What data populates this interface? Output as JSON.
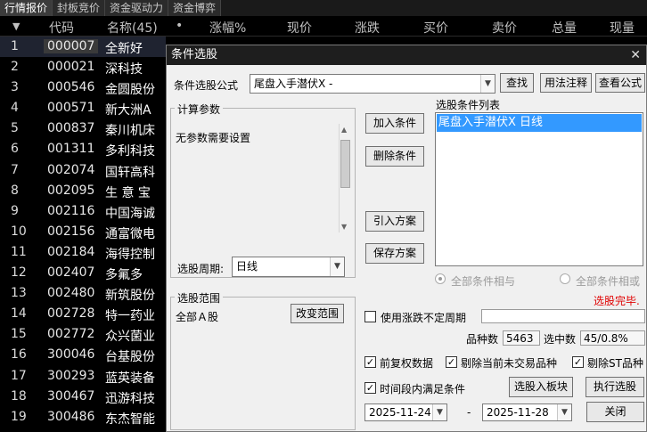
{
  "tabs": [
    "行情报价",
    "封板竞价",
    "资金驱动力",
    "资金博弈"
  ],
  "columns": {
    "sort": "▼",
    "code": "代码",
    "name": "名称(45)",
    "dot": "•",
    "change_pct": "涨幅%",
    "price": "现价",
    "change": "涨跌",
    "bid": "买价",
    "ask": "卖价",
    "volume": "总量",
    "cur_vol": "现量"
  },
  "rows": [
    {
      "idx": "1",
      "code": "000007",
      "name": "全新好"
    },
    {
      "idx": "2",
      "code": "000021",
      "name": "深科技"
    },
    {
      "idx": "3",
      "code": "000546",
      "name": "金圆股份"
    },
    {
      "idx": "4",
      "code": "000571",
      "name": "新大洲A"
    },
    {
      "idx": "5",
      "code": "000837",
      "name": "秦川机床"
    },
    {
      "idx": "6",
      "code": "001311",
      "name": "多利科技"
    },
    {
      "idx": "7",
      "code": "002074",
      "name": "国轩高科"
    },
    {
      "idx": "8",
      "code": "002095",
      "name": "生 意 宝"
    },
    {
      "idx": "9",
      "code": "002116",
      "name": "中国海诚"
    },
    {
      "idx": "10",
      "code": "002156",
      "name": "通富微电"
    },
    {
      "idx": "11",
      "code": "002184",
      "name": "海得控制"
    },
    {
      "idx": "12",
      "code": "002407",
      "name": "多氟多"
    },
    {
      "idx": "13",
      "code": "002480",
      "name": "新筑股份"
    },
    {
      "idx": "14",
      "code": "002728",
      "name": "特一药业"
    },
    {
      "idx": "15",
      "code": "002772",
      "name": "众兴菌业"
    },
    {
      "idx": "16",
      "code": "300046",
      "name": "台基股份"
    },
    {
      "idx": "17",
      "code": "300293",
      "name": "蓝英装备"
    },
    {
      "idx": "18",
      "code": "300467",
      "name": "迅游科技"
    },
    {
      "idx": "19",
      "code": "300486",
      "name": "东杰智能"
    }
  ],
  "dialog": {
    "title": "条件选股",
    "close_icon": "✕",
    "formula_label": "条件选股公式",
    "formula_value": "尾盘入手潜伏X  -",
    "btn_find": "查找",
    "btn_usage": "用法注释",
    "btn_view": "查看公式",
    "params_title": "计算参数",
    "params_text": "无参数需要设置",
    "period_label": "选股周期:",
    "period_value": "日线",
    "btn_add": "加入条件",
    "btn_delete": "删除条件",
    "btn_import": "引入方案",
    "btn_save": "保存方案",
    "cond_list_title": "选股条件列表",
    "cond_item": "尾盘入手潜伏X  日线",
    "radio_and": "全部条件相与",
    "radio_or": "全部条件相或",
    "status": "选股完毕.",
    "range_title": "选股范围",
    "range_value": "全部Ａ股",
    "btn_change_range": "改变范围",
    "chk_uncertain_label": "使用涨跌不定周期",
    "count_label": "品种数",
    "count_value": "5463",
    "selected_label": "选中数",
    "selected_value": "45/0.8%",
    "chk_fq_label": "前复权数据",
    "chk_notrade_label": "剔除当前未交易品种",
    "chk_st_label": "剔除ST品种",
    "chk_period_label": "时间段内满足条件",
    "btn_to_block": "选股入板块",
    "btn_execute": "执行选股",
    "date_from": "2025-11-24",
    "date_sep": "-",
    "date_to": "2025-11-28",
    "btn_close": "关闭",
    "check_mark": "✓",
    "dropdown_icon": "▼"
  }
}
